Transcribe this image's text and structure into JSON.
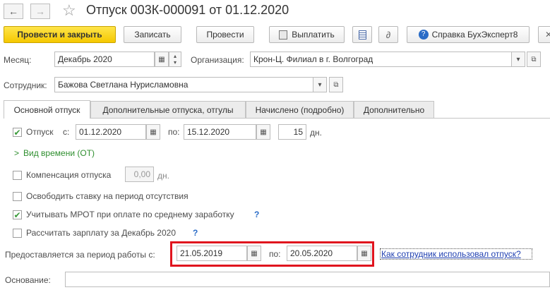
{
  "window": {
    "title": "Отпуск 003К-000091 от 01.12.2020",
    "back_icon": "←",
    "forward_icon": "→",
    "star_icon": "☆"
  },
  "toolbar": {
    "post_close": "Провести и закрыть",
    "save": "Записать",
    "post": "Провести",
    "pay": "Выплатить",
    "help": "Справка БухЭксперт8"
  },
  "header": {
    "month_label": "Месяц:",
    "month_value": "Декабрь 2020",
    "org_label": "Организация:",
    "org_value": "Крон-Ц. Филиал в г. Волгоград",
    "employee_label": "Сотрудник:",
    "employee_value": "Бажова Светлана Нурисламовна"
  },
  "tabs": [
    "Основной отпуск",
    "Дополнительные отпуска, отгулы",
    "Начислено (подробно)",
    "Дополнительно"
  ],
  "main": {
    "leave_label": "Отпуск",
    "from_label": "с:",
    "from_value": "01.12.2020",
    "to_label": "по:",
    "to_value": "15.12.2020",
    "days_value": "15",
    "days_label": "дн.",
    "time_kind": "Вид времени (ОТ)",
    "compensation_label": "Компенсация отпуска",
    "compensation_value": "0,00",
    "compensation_unit": "дн.",
    "release_rate": "Освободить ставку на период отсутствия",
    "mrot": "Учитывать МРОТ при оплате по среднему заработку",
    "calc_salary": "Рассчитать зарплату за Декабрь 2020",
    "help_mark": "?",
    "period_label": "Предоставляется за период работы с:",
    "period_from": "21.05.2019",
    "period_to_label": "по:",
    "period_to": "20.05.2020",
    "usage_link": "Как сотрудник использовал отпуск?",
    "basis_label": "Основание:"
  },
  "colors": {
    "primary_button": "#f5c800",
    "highlight_frame": "#e0141e",
    "link": "#1f3fb0",
    "check": "#3a9a3a"
  }
}
